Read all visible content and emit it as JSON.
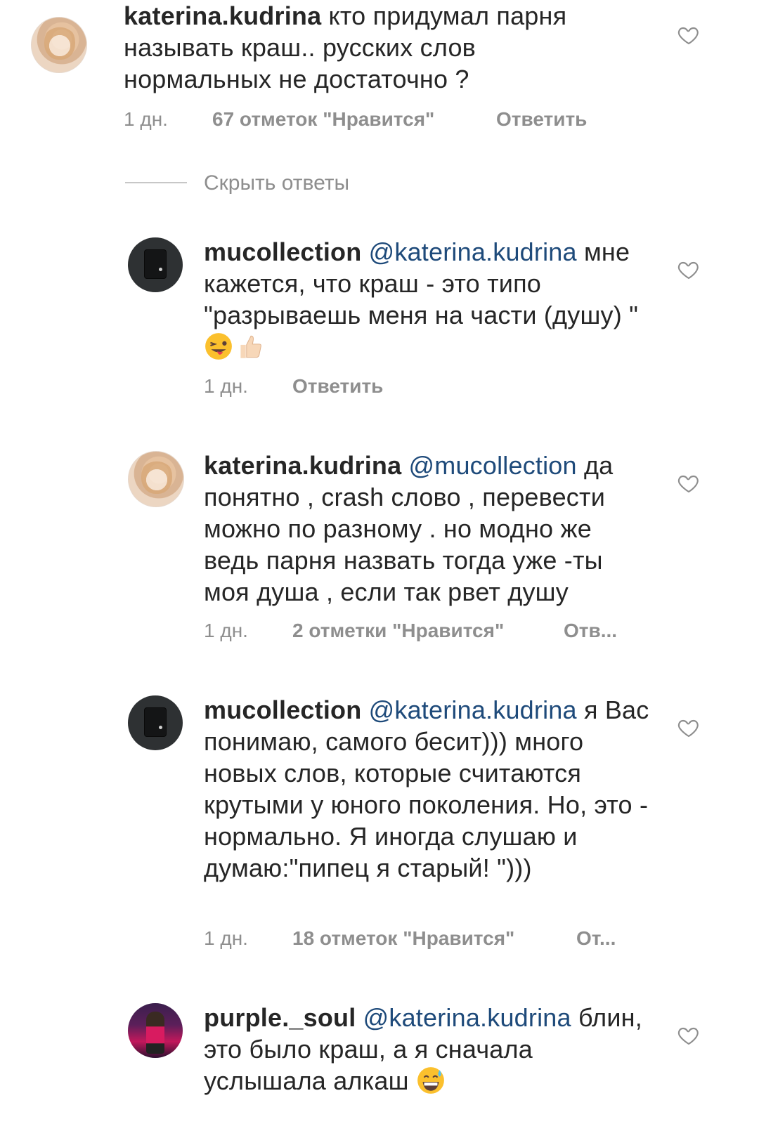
{
  "hide_replies_label": "Скрыть ответы",
  "comments": [
    {
      "username": "katerina.kudrina",
      "mention": "",
      "text": "кто придумал парня называть краш.. русских слов нормальных не достаточно ?",
      "time": "1 дн.",
      "likes": "67 отметок \"Нравится\"",
      "reply": "Ответить"
    },
    {
      "username": "mucollection",
      "mention": "@katerina.kudrina",
      "text": "мне кажется, что краш - это типо \"разрываешь меня на части (душу) \"",
      "emojis": [
        "winking-face-with-tongue-emoji",
        "thumbs-up-emoji"
      ],
      "time": "1 дн.",
      "likes": "",
      "reply": "Ответить"
    },
    {
      "username": "katerina.kudrina",
      "mention": "@mucollection",
      "text": "да понятно , crash слово , перевести можно по разному . но модно же ведь парня назвать тогда уже -ты моя душа , если так рвет душу",
      "time": "1 дн.",
      "likes": "2 отметки \"Нравится\"",
      "reply": "Отв..."
    },
    {
      "username": "mucollection",
      "mention": "@katerina.kudrina",
      "text": "я Вас понимаю, самого бесит))) много новых слов, которые считаются крутыми у юного поколения. Но, это - нормально. Я иногда слушаю и думаю:\"пипец я старый! \")))",
      "time": "1 дн.",
      "likes": "18 отметок \"Нравится\"",
      "reply": "От..."
    },
    {
      "username": "purple._soul",
      "mention": "@katerina.kudrina",
      "text": "блин, это было краш, а я сначала услышала алкаш",
      "emojis": [
        "grinning-face-with-sweat-emoji"
      ],
      "time": "",
      "likes": "",
      "reply": ""
    }
  ]
}
